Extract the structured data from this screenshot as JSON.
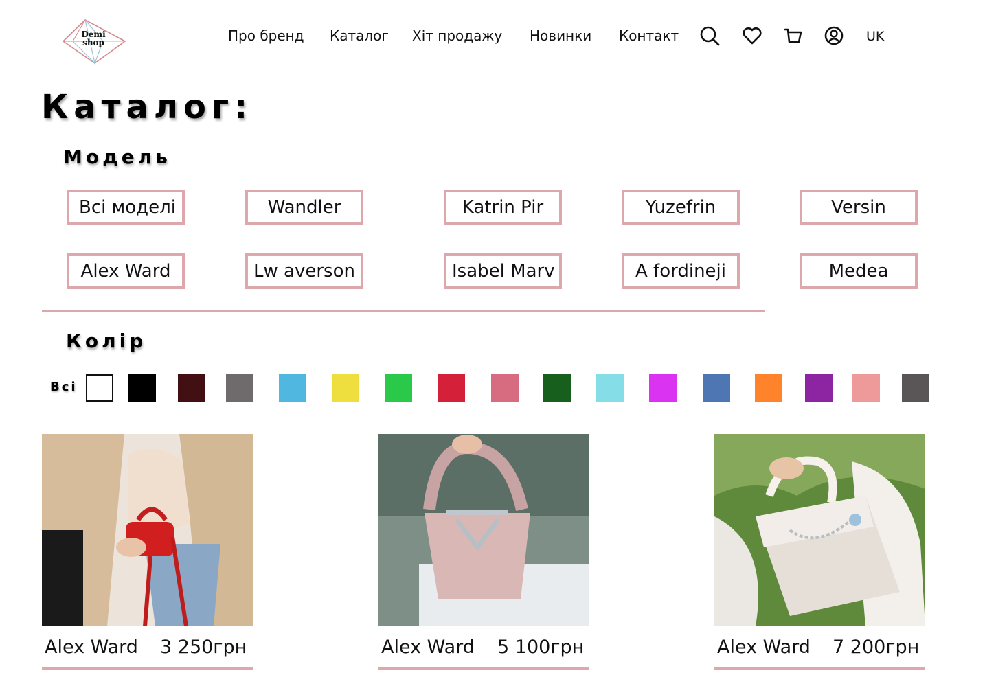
{
  "header": {
    "logo_text_top": "Demi",
    "logo_text_bottom": "shop",
    "nav": [
      "Про бренд",
      "Каталог",
      "Хіт продажу",
      "Новинки",
      "Контакт"
    ],
    "icons": [
      "search-icon",
      "heart-icon",
      "cart-icon",
      "account-icon"
    ],
    "language": "UK"
  },
  "page_title": "Каталог:",
  "model_section": {
    "title": "Модель",
    "models": [
      "Всі моделі",
      "Wandler",
      "Katrin Pir",
      "Yuzefrin",
      "Versin",
      "Alex Ward",
      "Lw averson",
      "Isabel Marv",
      "A fordineji",
      "Medea"
    ]
  },
  "color_section": {
    "title": "Колір",
    "all_label": "Всі",
    "swatches": [
      "#ffffff",
      "#000000",
      "#420f12",
      "#6f6b6c",
      "#4fb7e0",
      "#eedf3e",
      "#2ac94a",
      "#d5203a",
      "#d76b7f",
      "#165f1c",
      "#85dde7",
      "#db33f2",
      "#4d76b3",
      "#ff832a",
      "#8d24a2",
      "#ee9a9b",
      "#5a5657"
    ]
  },
  "products": [
    {
      "name": "Alex Ward",
      "price": "3 250грн",
      "image": "red mini bag"
    },
    {
      "name": "Alex Ward",
      "price": "5 100грн",
      "image": "pink handbag"
    },
    {
      "name": "Alex Ward",
      "price": "7 200грн",
      "image": "white chain bag"
    }
  ],
  "colors": {
    "accent": "#dea7ab",
    "text": "#111111"
  }
}
